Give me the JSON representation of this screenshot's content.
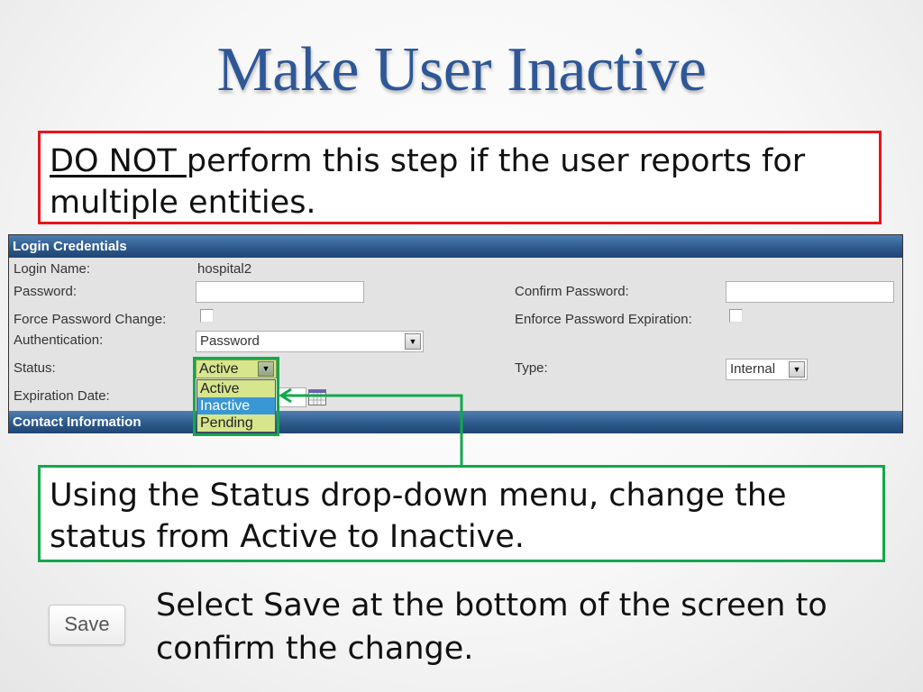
{
  "slide": {
    "title": "Make User Inactive",
    "warning": {
      "emphasis": "DO NOT ",
      "text": "perform this step if the user reports for multiple entities."
    },
    "instruction": "Using the Status drop-down menu, change the status from Active to Inactive.",
    "save_instruction": "Select Save at the bottom of the screen to confirm the change.",
    "save_button_label": "Save",
    "colors": {
      "title": "#2e5797",
      "warning_border": "#e8141c",
      "highlight_border": "#12a84b",
      "header_bar": "#2e5a8c"
    }
  },
  "form": {
    "section_login": "Login Credentials",
    "section_contact": "Contact Information",
    "login_name_label": "Login Name:",
    "login_name_value": "hospital2",
    "password_label": "Password:",
    "password_value": "",
    "confirm_password_label": "Confirm Password:",
    "confirm_password_value": "",
    "force_password_change_label": "Force Password Change:",
    "force_password_change_checked": false,
    "enforce_password_expiration_label": "Enforce Password Expiration:",
    "enforce_password_expiration_checked": false,
    "authentication_label": "Authentication:",
    "authentication_value": "Password",
    "status_label": "Status:",
    "status_value": "Active",
    "status_options": [
      "Active",
      "Inactive",
      "Pending"
    ],
    "status_highlighted_option": "Inactive",
    "type_label": "Type:",
    "type_value": "Internal",
    "expiration_date_label": "Expiration Date:",
    "expiration_date_value": ""
  }
}
